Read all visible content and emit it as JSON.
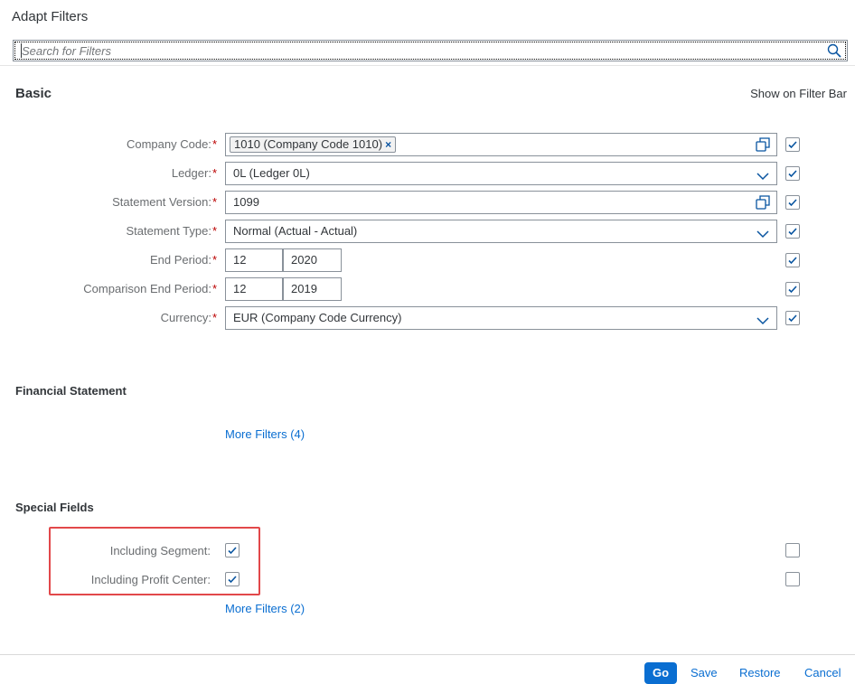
{
  "dialog": {
    "title": "Adapt Filters"
  },
  "search": {
    "placeholder": "Search for Filters",
    "value": ""
  },
  "header": {
    "show_on_filter_bar": "Show on Filter Bar"
  },
  "basic": {
    "title": "Basic",
    "fields": {
      "company_code": {
        "label": "Company Code:",
        "required": "*",
        "token": "1010 (Company Code 1010)",
        "token_remove": "×"
      },
      "ledger": {
        "label": "Ledger:",
        "required": "*",
        "value": "0L (Ledger 0L)"
      },
      "statement_version": {
        "label": "Statement Version:",
        "required": "*",
        "value": "1099"
      },
      "statement_type": {
        "label": "Statement Type:",
        "required": "*",
        "value": "Normal (Actual - Actual)"
      },
      "end_period": {
        "label": "End Period:",
        "required": "*",
        "period": "12",
        "year": "2020"
      },
      "comparison_end_period": {
        "label": "Comparison End Period:",
        "required": "*",
        "period": "12",
        "year": "2019"
      },
      "currency": {
        "label": "Currency:",
        "required": "*",
        "value": "EUR (Company Code Currency)"
      }
    }
  },
  "financial_statement": {
    "title": "Financial Statement",
    "more_filters": "More Filters (4)"
  },
  "special_fields": {
    "title": "Special Fields",
    "including_segment": {
      "label": "Including Segment:",
      "checked": true,
      "show_on_bar": false
    },
    "including_profit_center": {
      "label": "Including Profit Center:",
      "checked": true,
      "show_on_bar": false
    },
    "more_filters": "More Filters (2)"
  },
  "footer": {
    "go": "Go",
    "save": "Save",
    "restore": "Restore",
    "cancel": "Cancel"
  },
  "colors": {
    "accent": "#0a6ed1",
    "required": "#bb0000",
    "highlight": "#e2484a"
  }
}
